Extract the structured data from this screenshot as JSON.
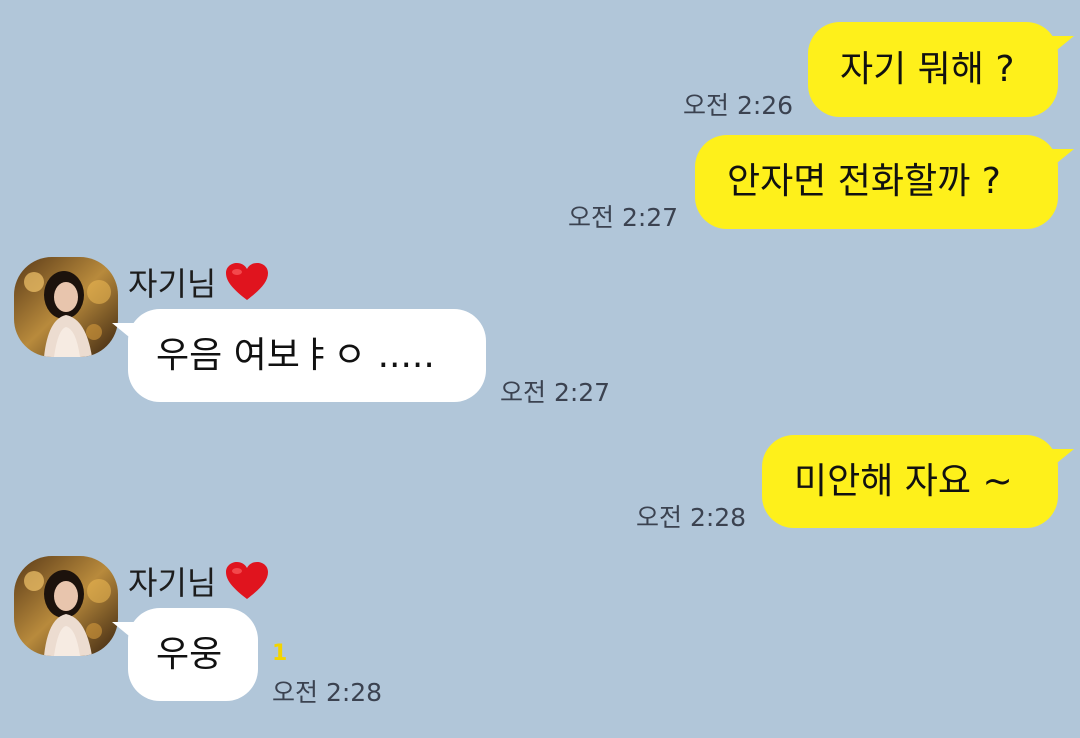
{
  "chat": {
    "contact_name": "자기님",
    "contact_name_icon": "heart-icon",
    "unread_color": "#f3d400",
    "my_bubble_color": "#fef01b",
    "their_bubble_color": "#ffffff",
    "background_color": "#b1c6d9",
    "messages": [
      {
        "sender": "me",
        "text": "자기 뭐해 ?",
        "time": "오전 2:26"
      },
      {
        "sender": "me",
        "text": "안자면 전화할까 ?",
        "time": "오전 2:27"
      },
      {
        "sender": "them",
        "name": "자기님",
        "text": "우음 여보ㅑㅇ .....",
        "time": "오전 2:27"
      },
      {
        "sender": "me",
        "text": "미안해 자요 ~",
        "time": "오전 2:28"
      },
      {
        "sender": "them",
        "name": "자기님",
        "text": "우웅",
        "time": "오전 2:28",
        "unread": "1"
      }
    ]
  }
}
